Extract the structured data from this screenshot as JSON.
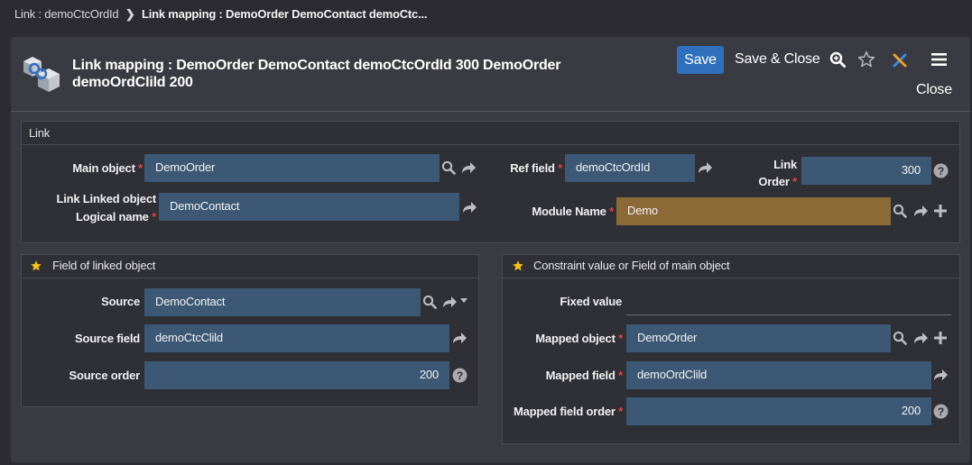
{
  "breadcrumb": {
    "item1": "Link : demoCtcOrdId",
    "item2": "Link mapping : DemoOrder DemoContact demoCtc..."
  },
  "header": {
    "title_line1": "Link mapping : DemoOrder DemoContact demoCtcOrdId 300 DemoOrder",
    "title_line2": "demoOrdClild 200",
    "save": "Save",
    "save_close": "Save & Close",
    "close": "Close"
  },
  "link_panel": {
    "title": "Link",
    "main_object_label": "Main object",
    "main_object_value": "DemoOrder",
    "ref_field_label": "Ref field",
    "ref_field_value": "demoCtcOrdId",
    "link_order_label_1": "Link",
    "link_order_label_2": "Order",
    "link_order_value": "300",
    "linked_object_label_1": "Link Linked object",
    "linked_object_label_2": "Logical name",
    "linked_object_value": "DemoContact",
    "module_name_label": "Module Name",
    "module_name_value": "Demo"
  },
  "field_panel": {
    "title": "Field of linked object",
    "source_label": "Source",
    "source_value": "DemoContact",
    "source_field_label": "Source field",
    "source_field_value": "demoCtcClild",
    "source_order_label": "Source order",
    "source_order_value": "200"
  },
  "constraint_panel": {
    "title": "Constraint value or Field of main object",
    "fixed_value_label": "Fixed value",
    "mapped_object_label": "Mapped object",
    "mapped_object_value": "DemoOrder",
    "mapped_field_label": "Mapped field",
    "mapped_field_value": "demoOrdClild",
    "mapped_field_order_label": "Mapped field order",
    "mapped_field_order_value": "200"
  },
  "colors": {
    "accent": "#2f70bd",
    "field_bg": "#3c5874",
    "module_bg": "#8b6a37",
    "required": "#e0443e",
    "star": "#f3c316"
  }
}
